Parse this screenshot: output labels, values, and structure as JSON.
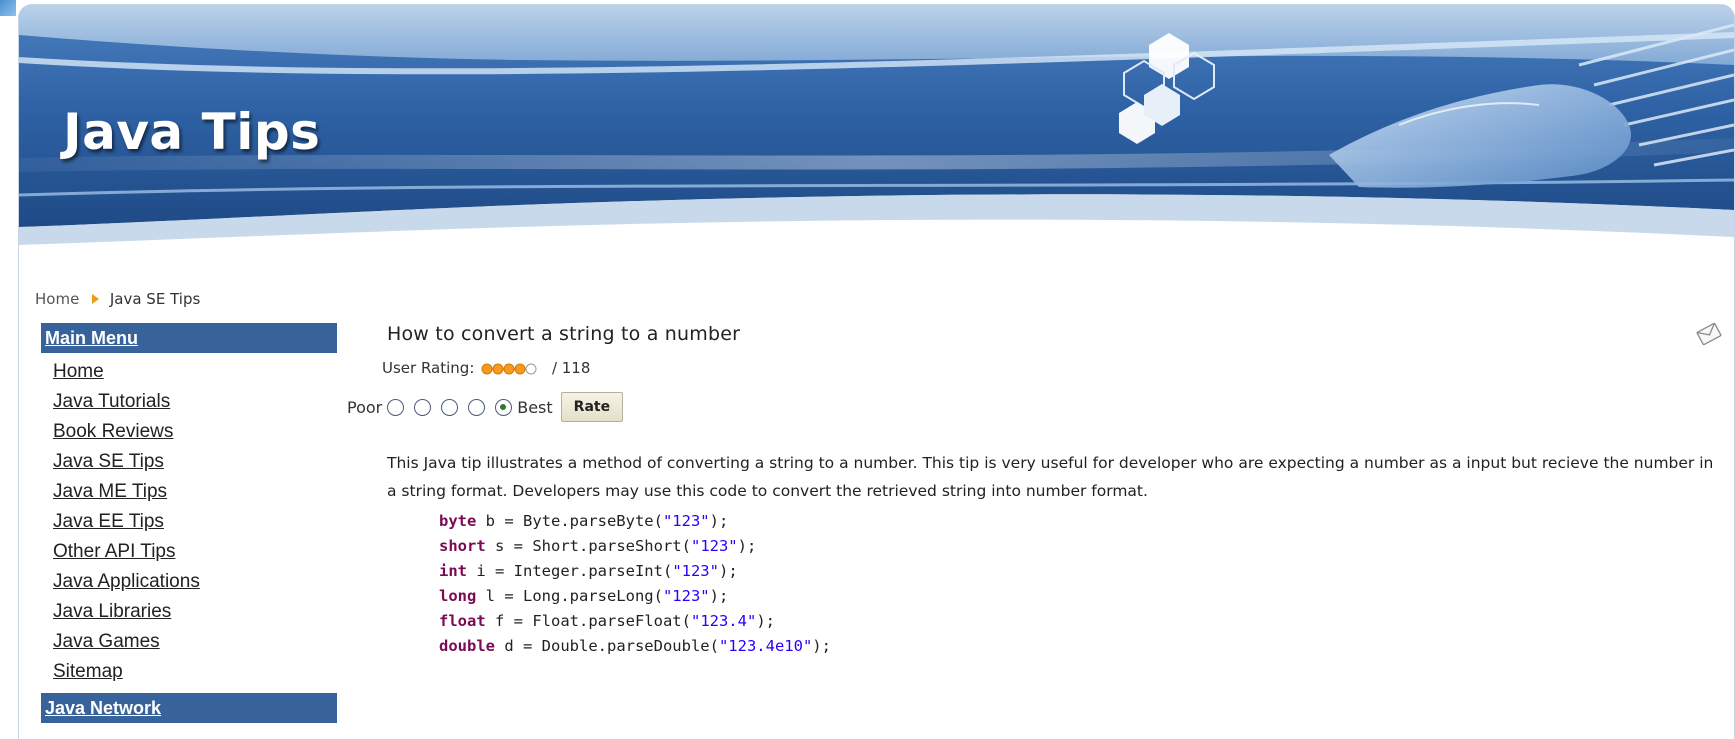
{
  "site": {
    "logo_text": "Java Tips"
  },
  "breadcrumb": {
    "items": [
      "Home",
      "Java SE Tips"
    ]
  },
  "sidebar": {
    "main_menu_title": "Main Menu",
    "items": [
      {
        "label": "Home"
      },
      {
        "label": "Java Tutorials"
      },
      {
        "label": "Book Reviews"
      },
      {
        "label": "Java SE Tips"
      },
      {
        "label": "Java ME Tips"
      },
      {
        "label": "Java EE Tips"
      },
      {
        "label": "Other API Tips"
      },
      {
        "label": "Java Applications"
      },
      {
        "label": "Java Libraries"
      },
      {
        "label": "Java Games"
      },
      {
        "label": "Sitemap"
      }
    ],
    "network_title": "Java Network"
  },
  "article": {
    "title": "How to convert a string to a number",
    "rating_label": "User Rating:",
    "rating_count": "/ 118",
    "rating_value": 4,
    "rating_max": 5,
    "vote_poor_label": "Poor",
    "vote_best_label": "Best",
    "vote_options": 5,
    "vote_selected": 5,
    "rate_button_label": "Rate",
    "description": "This Java tip illustrates a method of converting a string to a number. This tip is very useful for developer who are expecting a number as a input but recieve the number in a string format. Developers may use this code to convert the retrieved string into number format.",
    "code_lines": [
      {
        "keyword": "byte",
        "pre": " b = Byte.parseByte(",
        "str": "\"123\"",
        "post": ");"
      },
      {
        "keyword": "short",
        "pre": " s = Short.parseShort(",
        "str": "\"123\"",
        "post": ");"
      },
      {
        "keyword": "int",
        "pre": " i = Integer.parseInt(",
        "str": "\"123\"",
        "post": ");"
      },
      {
        "keyword": "long",
        "pre": " l = Long.parseLong(",
        "str": "\"123\"",
        "post": ");"
      },
      {
        "keyword": "float",
        "pre": " f = Float.parseFloat(",
        "str": "\"123.4\"",
        "post": ");"
      },
      {
        "keyword": "double",
        "pre": " d = Double.parseDouble(",
        "str": "\"123.4e10\"",
        "post": ");"
      }
    ]
  },
  "icons": {
    "email": "email-icon",
    "breadcrumb_separator": "arrow-right-icon",
    "rating": "star-rating-icon"
  },
  "colors": {
    "menu_header_bg": "#37629a",
    "breadcrumb_arrow": "#f19a1a",
    "code_keyword": "#7b0a55",
    "code_string": "#2a00ff"
  }
}
